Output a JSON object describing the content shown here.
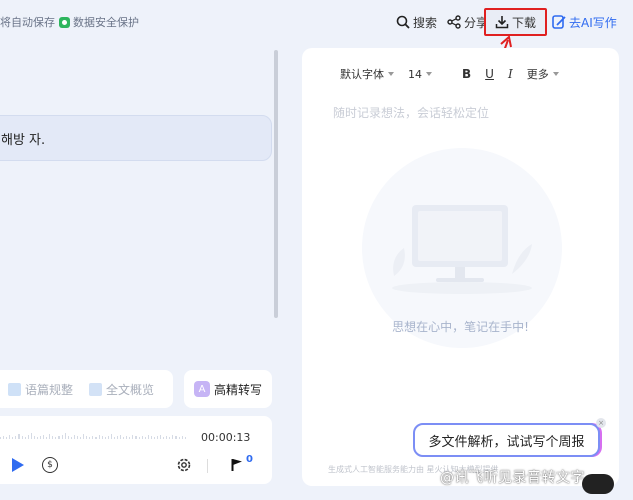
{
  "topbar": {
    "save_status": "将自动保存",
    "security": "数据安全保护",
    "search_label": "搜索",
    "share_label": "分享",
    "download_label": "下载",
    "ai_write_label": "去AI写作"
  },
  "transcript": {
    "bubble_text": "해방 자."
  },
  "tools": {
    "paragraph_label": "语篇规整",
    "overview_label": "全文概览",
    "hq_label": "高精转写",
    "hq_icon_letter": "A"
  },
  "player": {
    "time": "00:00:13",
    "speed_glyph": "$",
    "flag_count": "0"
  },
  "editor": {
    "font_family": "默认字体",
    "font_size": "14",
    "bold": "B",
    "underline": "U",
    "italic": "I",
    "more": "更多",
    "placeholder": "随时记录想法，会话轻松定位",
    "empty_message": "思想在心中，笔记在手中!",
    "footer_note": "生成式人工智能服务能力由 星火认知大模型提供"
  },
  "tip": {
    "text": "多文件解析，试试写个周报",
    "close_glyph": "×"
  },
  "watermark": {
    "text": "@讯飞听见录音转文字"
  },
  "colors": {
    "accent": "#2f6bf0",
    "highlight_border": "#e02020",
    "background": "#eef2fa"
  }
}
